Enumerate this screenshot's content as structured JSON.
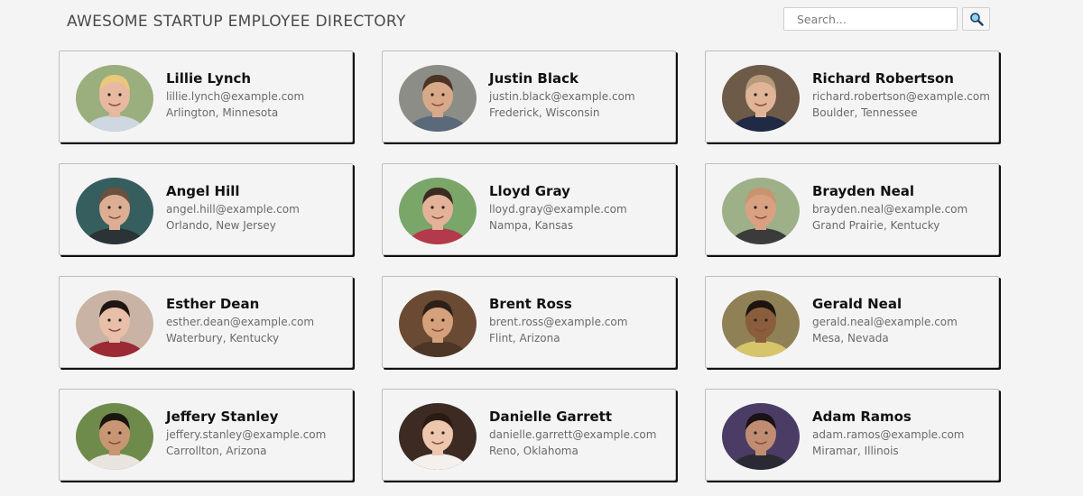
{
  "header": {
    "title": "AWESOME STARTUP EMPLOYEE DIRECTORY",
    "search_placeholder": "Search...",
    "search_icon": "magnifier-icon"
  },
  "employees": [
    {
      "name": "Lillie Lynch",
      "email": "lillie.lynch@example.com",
      "location": "Arlington, Minnesota",
      "bg": "#9aae7e",
      "skin": "#e6b9a0",
      "hair": "#e9c979",
      "shirt": "#cfd7e0"
    },
    {
      "name": "Justin Black",
      "email": "justin.black@example.com",
      "location": "Frederick, Wisconsin",
      "bg": "#8d8d88",
      "skin": "#d7a989",
      "hair": "#4a3425",
      "shirt": "#5a6a7a"
    },
    {
      "name": "Richard Robertson",
      "email": "richard.robertson@example.com",
      "location": "Boulder, Tennessee",
      "bg": "#6e5a48",
      "skin": "#e0b497",
      "hair": "#b59a7a",
      "shirt": "#1f2a44"
    },
    {
      "name": "Angel Hill",
      "email": "angel.hill@example.com",
      "location": "Orlando, New Jersey",
      "bg": "#365e5f",
      "skin": "#dcae94",
      "hair": "#6a513d",
      "shirt": "#2b3336"
    },
    {
      "name": "Lloyd Gray",
      "email": "lloyd.gray@example.com",
      "location": "Nampa, Kansas",
      "bg": "#7aa66a",
      "skin": "#e3b298",
      "hair": "#3a2a20",
      "shirt": "#b3394b"
    },
    {
      "name": "Brayden Neal",
      "email": "brayden.neal@example.com",
      "location": "Grand Prairie, Kentucky",
      "bg": "#9eb088",
      "skin": "#d9a182",
      "hair": "#c8946f",
      "shirt": "#3b3b3b"
    },
    {
      "name": "Esther Dean",
      "email": "esther.dean@example.com",
      "location": "Waterbury, Kentucky",
      "bg": "#c9b3a4",
      "skin": "#e8bfa8",
      "hair": "#1f1614",
      "shirt": "#9b2a34"
    },
    {
      "name": "Brent Ross",
      "email": "brent.ross@example.com",
      "location": "Flint, Arizona",
      "bg": "#6b4a34",
      "skin": "#d5a07c",
      "hair": "#2e2018",
      "shirt": "#4e3626"
    },
    {
      "name": "Gerald Neal",
      "email": "gerald.neal@example.com",
      "location": "Mesa, Nevada",
      "bg": "#8f8155",
      "skin": "#8a5e3c",
      "hair": "#1c140e",
      "shirt": "#d7c56b"
    },
    {
      "name": "Jeffery Stanley",
      "email": "jeffery.stanley@example.com",
      "location": "Carrollton, Arizona",
      "bg": "#6e8b4c",
      "skin": "#c99673",
      "hair": "#1b1510",
      "shirt": "#e9e5de"
    },
    {
      "name": "Danielle Garrett",
      "email": "danielle.garrett@example.com",
      "location": "Reno, Oklahoma",
      "bg": "#3d2b23",
      "skin": "#edc6ae",
      "hair": "#2a1a14",
      "shirt": "#f3f0ee"
    },
    {
      "name": "Adam Ramos",
      "email": "adam.ramos@example.com",
      "location": "Miramar, Illinois",
      "bg": "#4a3c64",
      "skin": "#c08d72",
      "hair": "#1a1216",
      "shirt": "#2a2a35"
    }
  ]
}
